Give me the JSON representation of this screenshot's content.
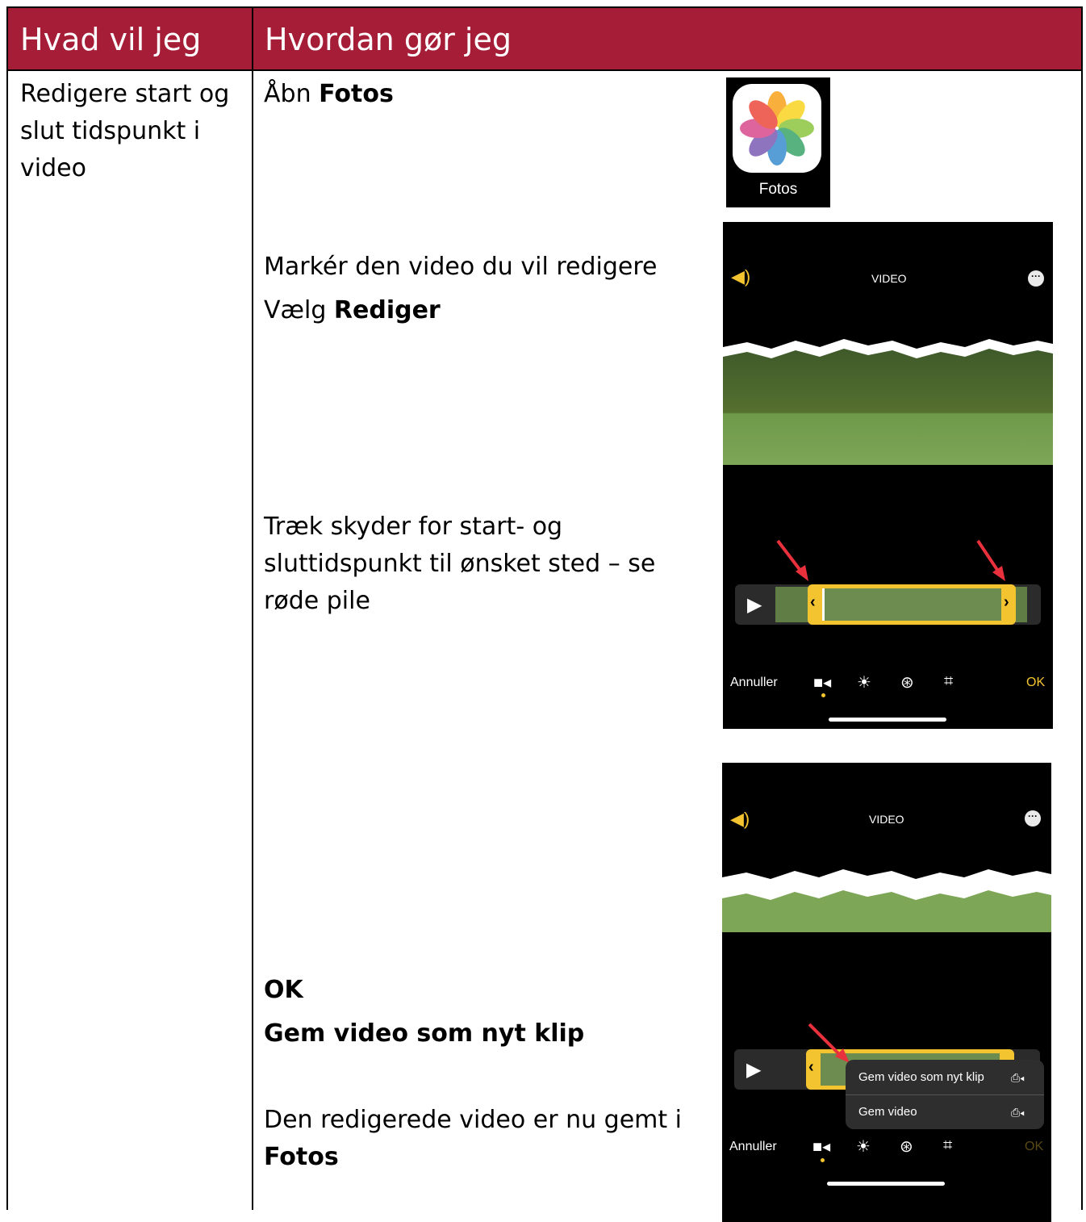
{
  "header": {
    "col1": "Hvad vil jeg",
    "col2": "Hvordan gør jeg"
  },
  "row": {
    "what": [
      "Redigere start og",
      "slut tidspunkt i",
      "video"
    ],
    "steps": {
      "open_prefix": "Åbn ",
      "open_app": "Fotos",
      "mark_line": "Markér den video du vil redigere",
      "choose_prefix": "Vælg ",
      "choose_action": "Rediger",
      "drag_lines": [
        "Træk skyder for start- og",
        "sluttidspunkt til ønsket sted – se",
        "røde pile"
      ],
      "ok": "OK",
      "save_new": "Gem video som nyt klip",
      "saved_line": "Den redigerede video er nu gemt i",
      "saved_app": "Fotos"
    }
  },
  "app_icon": {
    "label": "Fotos"
  },
  "screen1": {
    "title": "VIDEO",
    "cancel": "Annuller",
    "ok": "OK"
  },
  "screen2": {
    "title": "VIDEO",
    "cancel": "Annuller",
    "ok": "OK",
    "menu": [
      "Gem video som nyt klip",
      "Gem video"
    ]
  },
  "colors": {
    "header_bg": "#a51d36",
    "accent_yellow": "#f4c430",
    "arrow_red": "#e8313c"
  }
}
